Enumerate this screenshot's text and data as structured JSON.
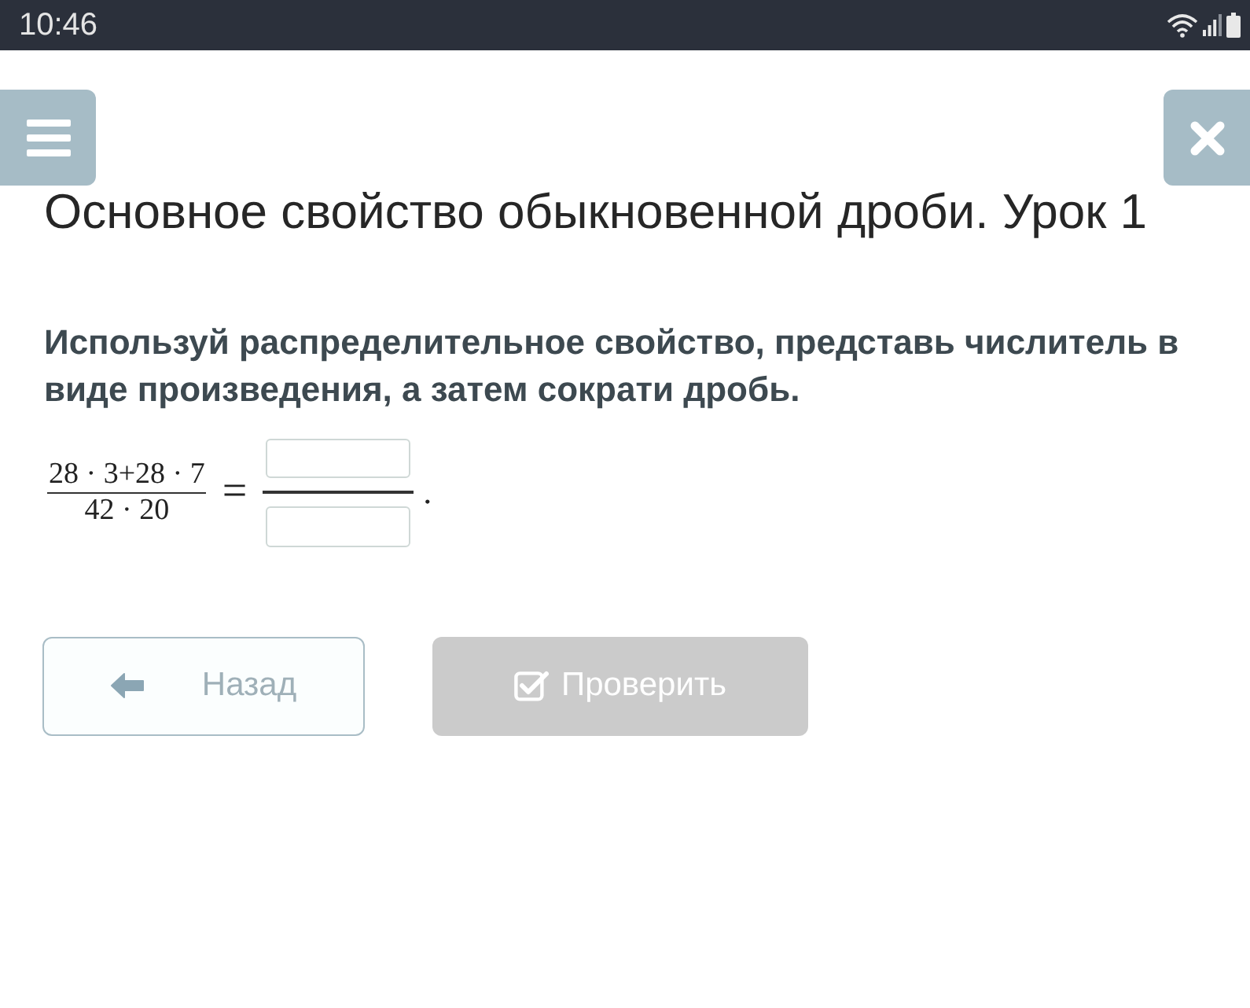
{
  "status_bar": {
    "time": "10:46"
  },
  "header": {
    "title": "Основное свойство обыкновенной дроби. Урок 1"
  },
  "task": {
    "instruction": "Используй распределительное свойство, представь числитель в виде произведения, а затем сократи дробь.",
    "expression": {
      "numerator": "28 · 3+28 · 7",
      "denominator": "42 · 20"
    },
    "equals": "=",
    "end_mark": "."
  },
  "buttons": [
    {
      "kind": "back",
      "label": "Назад",
      "disabled": false
    },
    {
      "kind": "check",
      "label": "Проверить",
      "disabled": true
    }
  ]
}
